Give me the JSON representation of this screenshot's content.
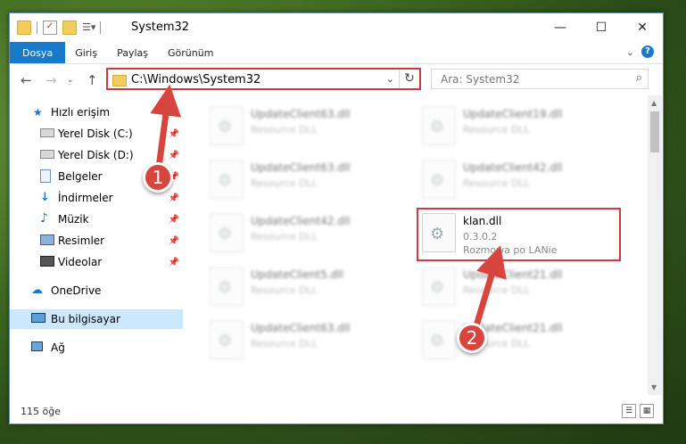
{
  "window": {
    "title": "System32",
    "controls": {
      "minimize": "—",
      "maximize": "☐",
      "close": "✕"
    }
  },
  "ribbon": {
    "tabs": [
      "Dosya",
      "Giriş",
      "Paylaş",
      "Görünüm"
    ]
  },
  "address": {
    "path": "C:\\Windows\\System32"
  },
  "search": {
    "placeholder": "Ara: System32"
  },
  "sidebar": {
    "items": [
      {
        "label": "Hızlı erişim",
        "icon": "star-icon"
      },
      {
        "label": "Yerel Disk (C:)",
        "icon": "drive-icon",
        "pinned": true
      },
      {
        "label": "Yerel Disk (D:)",
        "icon": "drive-icon",
        "pinned": true
      },
      {
        "label": "Belgeler",
        "icon": "documents-icon",
        "pinned": true
      },
      {
        "label": "İndirmeler",
        "icon": "download-icon",
        "pinned": true
      },
      {
        "label": "Müzik",
        "icon": "music-icon",
        "pinned": true
      },
      {
        "label": "Resimler",
        "icon": "pictures-icon",
        "pinned": true
      },
      {
        "label": "Videolar",
        "icon": "video-icon",
        "pinned": true
      },
      {
        "label": "OneDrive",
        "icon": "cloud-icon"
      },
      {
        "label": "Bu bilgisayar",
        "icon": "computer-icon",
        "selected": true
      },
      {
        "label": "Ağ",
        "icon": "network-icon"
      }
    ]
  },
  "files": {
    "left": [
      {
        "name": "UpdateClient63.dll",
        "desc": "Resource DLL"
      },
      {
        "name": "UpdateClient63.dll",
        "desc": "Resource DLL"
      },
      {
        "name": "UpdateClient42.dll",
        "desc": "Resource DLL"
      },
      {
        "name": "UpdateClient5.dll",
        "desc": "Resource DLL"
      },
      {
        "name": "UpdateClient63.dll",
        "desc": "Resource DLL"
      }
    ],
    "right": [
      {
        "name": "UpdateClient19.dll",
        "desc": "Resource DLL"
      },
      {
        "name": "UpdateClient42.dll",
        "desc": "Resource DLL"
      },
      {
        "name": "klan.dll",
        "desc": "0.3.0.2",
        "desc2": "Rozmowa po LANie",
        "highlight": true
      },
      {
        "name": "UpdateClient21.dll",
        "desc": "Resource DLL"
      },
      {
        "name": "UpdateClient21.dll",
        "desc": "Resource DLL"
      }
    ]
  },
  "status": {
    "count": "115 öğe"
  },
  "annotations": {
    "step1": "1",
    "step2": "2",
    "color": "#d8453f"
  }
}
